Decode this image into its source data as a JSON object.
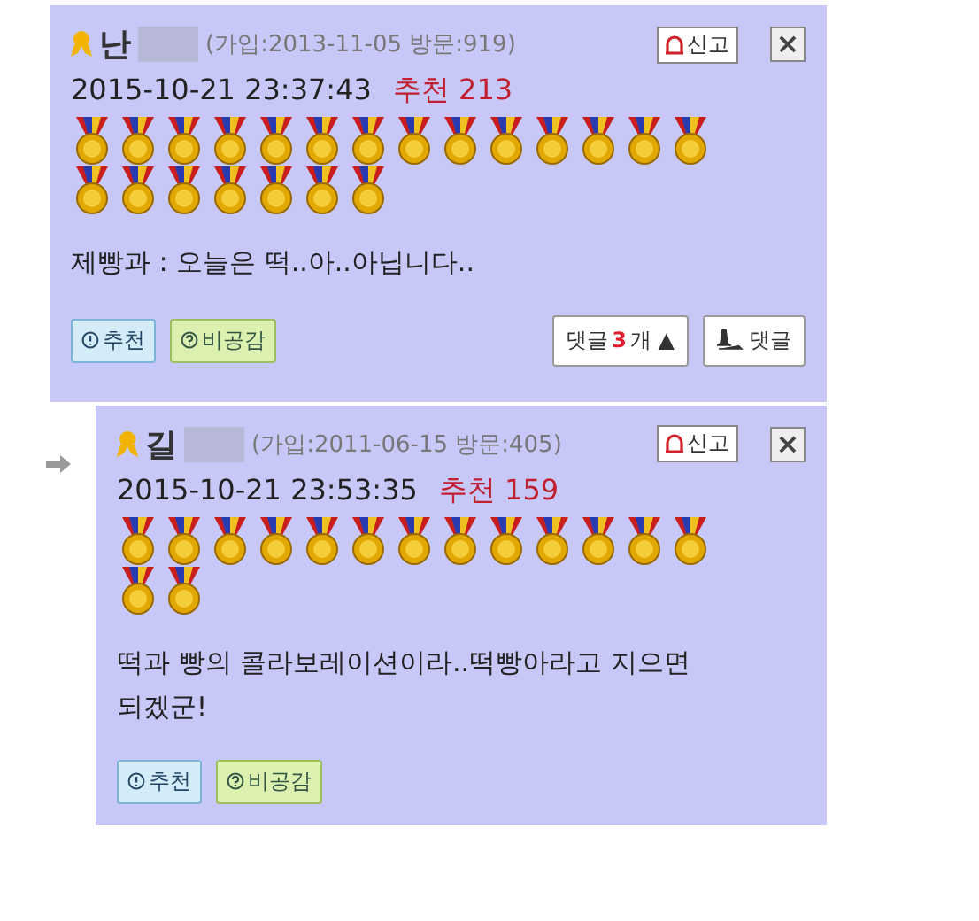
{
  "comments": [
    {
      "reply": false,
      "name": "난",
      "joined": "(가입:2013-11-05 방문:919)",
      "report": "신고",
      "close": "×",
      "date": "2015-10-21 23:37:43",
      "recommend": "추천 213",
      "medals": [
        {
          "kind": "gold"
        },
        {
          "kind": "gold"
        },
        {
          "kind": "gold"
        },
        {
          "kind": "gold"
        },
        {
          "kind": "gold"
        },
        {
          "kind": "gold"
        },
        {
          "kind": "gold"
        },
        {
          "kind": "gold"
        },
        {
          "kind": "gold"
        },
        {
          "kind": "gold"
        },
        {
          "kind": "gold"
        },
        {
          "kind": "gold"
        },
        {
          "kind": "gold"
        },
        {
          "kind": "gold"
        },
        {
          "kind": "gold"
        },
        {
          "kind": "gold"
        },
        {
          "kind": "gold"
        },
        {
          "kind": "gold"
        },
        {
          "kind": "gold"
        },
        {
          "kind": "gold"
        },
        {
          "kind": "gold"
        }
      ],
      "body": "제빵과 : 오늘은 떡..아..아닙니다..",
      "like": "추천",
      "unlike": "비공감",
      "replies_label": "댓글 ",
      "replies_count": "3",
      "replies_unit": "개 ▲",
      "reply_button": "댓글"
    },
    {
      "reply": true,
      "name": "길",
      "joined": "(가입:2011-06-15 방문:405)",
      "report": "신고",
      "close": "×",
      "date": "2015-10-21 23:53:35",
      "recommend": "추천 159",
      "medals": [
        {
          "kind": "gold"
        },
        {
          "kind": "gold"
        },
        {
          "kind": "gold"
        },
        {
          "kind": "gold"
        },
        {
          "kind": "gold"
        },
        {
          "kind": "gold"
        },
        {
          "kind": "gold"
        },
        {
          "kind": "gold"
        },
        {
          "kind": "gold"
        },
        {
          "kind": "gold"
        },
        {
          "kind": "gold"
        },
        {
          "kind": "gold"
        },
        {
          "kind": "gold"
        },
        {
          "kind": "gold"
        },
        {
          "kind": "gold"
        }
      ],
      "body": "떡과 빵의 콜라보레이션이라..떡빵아라고 지으면 되겠군!",
      "like": "추천",
      "unlike": "비공감"
    }
  ]
}
